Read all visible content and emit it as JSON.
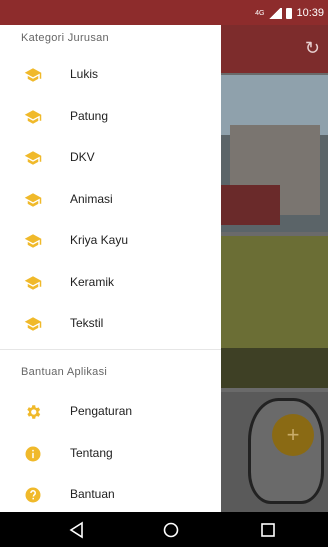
{
  "status_bar": {
    "time": "10:39",
    "network": "4G"
  },
  "drawer": {
    "section1_title": "Kategori Jurusan",
    "categories": [
      {
        "label": "Lukis",
        "icon": "graduation-cap-icon"
      },
      {
        "label": "Patung",
        "icon": "graduation-cap-icon"
      },
      {
        "label": "DKV",
        "icon": "graduation-cap-icon"
      },
      {
        "label": "Animasi",
        "icon": "graduation-cap-icon"
      },
      {
        "label": "Kriya Kayu",
        "icon": "graduation-cap-icon"
      },
      {
        "label": "Keramik",
        "icon": "graduation-cap-icon"
      },
      {
        "label": "Tekstil",
        "icon": "graduation-cap-icon"
      }
    ],
    "section2_title": "Bantuan Aplikasi",
    "help_items": [
      {
        "label": "Pengaturan",
        "icon": "gear-icon"
      },
      {
        "label": "Tentang",
        "icon": "info-icon"
      },
      {
        "label": "Bantuan",
        "icon": "help-icon"
      }
    ]
  },
  "fab": {
    "label": "+"
  },
  "colors": {
    "accent": "#f0b92a",
    "appbar": "#7d2c2c",
    "statusbar": "#8d2c2c"
  }
}
